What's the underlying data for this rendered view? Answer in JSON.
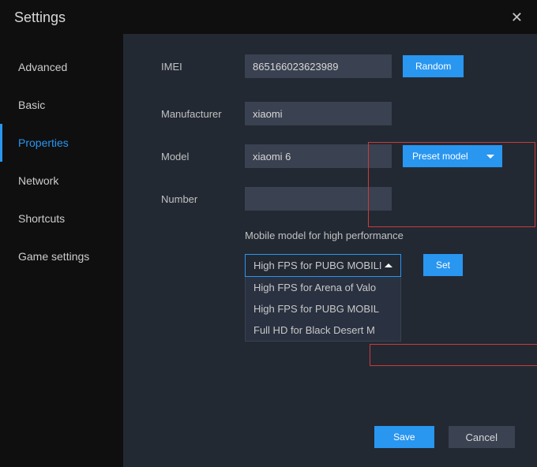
{
  "window": {
    "title": "Settings"
  },
  "sidebar": {
    "items": [
      {
        "label": "Advanced"
      },
      {
        "label": "Basic"
      },
      {
        "label": "Properties"
      },
      {
        "label": "Network"
      },
      {
        "label": "Shortcuts"
      },
      {
        "label": "Game settings"
      }
    ]
  },
  "form": {
    "imei": {
      "label": "IMEI",
      "value": "865166023623989",
      "button": "Random"
    },
    "manufacturer": {
      "label": "Manufacturer",
      "value": "xiaomi"
    },
    "model": {
      "label": "Model",
      "value": "xiaomi 6",
      "button": "Preset model"
    },
    "number": {
      "label": "Number",
      "value": ""
    }
  },
  "performance": {
    "label": "Mobile model for high performance",
    "selected": "High FPS for PUBG MOBILI",
    "set_button": "Set",
    "options": [
      "High FPS for Arena of Valo",
      "High FPS for PUBG MOBIL",
      "Full HD for Black Desert M"
    ]
  },
  "footer": {
    "save": "Save",
    "cancel": "Cancel"
  }
}
